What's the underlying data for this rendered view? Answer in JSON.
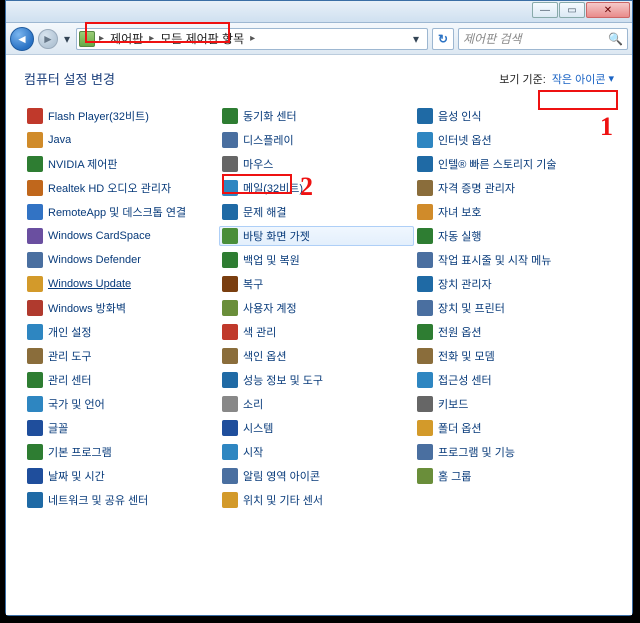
{
  "breadcrumb": {
    "root": "제어판",
    "path": "모든 제어판 항목"
  },
  "search": {
    "placeholder": "제어판 검색"
  },
  "heading": "컴퓨터 설정 변경",
  "view_label": "보기 기준:",
  "view_value": "작은 아이콘",
  "items": [
    {
      "label": "Flash Player(32비트)",
      "icon": "#c0392b"
    },
    {
      "label": "Java",
      "icon": "#d08b2a"
    },
    {
      "label": "NVIDIA 제어판",
      "icon": "#2e7d32"
    },
    {
      "label": "Realtek HD 오디오 관리자",
      "icon": "#c0671c"
    },
    {
      "label": "RemoteApp 및 데스크톱 연결",
      "icon": "#3273c4"
    },
    {
      "label": "Windows CardSpace",
      "icon": "#6a4fa0"
    },
    {
      "label": "Windows Defender",
      "icon": "#4a6fa0"
    },
    {
      "label": "Windows Update",
      "icon": "#d39a2a",
      "underline": true
    },
    {
      "label": "Windows 방화벽",
      "icon": "#b03a2e"
    },
    {
      "label": "개인 설정",
      "icon": "#2e86c1"
    },
    {
      "label": "관리 도구",
      "icon": "#8a6d3b"
    },
    {
      "label": "관리 센터",
      "icon": "#2e7d32"
    },
    {
      "label": "국가 및 언어",
      "icon": "#2e86c1"
    },
    {
      "label": "글꼴",
      "icon": "#1f4e9c"
    },
    {
      "label": "기본 프로그램",
      "icon": "#2e7d32"
    },
    {
      "label": "날짜 및 시간",
      "icon": "#1f4e9c"
    },
    {
      "label": "네트워크 및 공유 센터",
      "icon": "#1f6aa5"
    },
    {
      "label": "동기화 센터",
      "icon": "#2e7d32"
    },
    {
      "label": "디스플레이",
      "icon": "#4a6fa0"
    },
    {
      "label": "마우스",
      "icon": "#666"
    },
    {
      "label": "메일(32비트)",
      "icon": "#2e86c1"
    },
    {
      "label": "문제 해결",
      "icon": "#1f6aa5"
    },
    {
      "label": "바탕 화면 가젯",
      "icon": "#4a8e3a",
      "hover": true
    },
    {
      "label": "백업 및 복원",
      "icon": "#2e7d32"
    },
    {
      "label": "복구",
      "icon": "#7a3e10"
    },
    {
      "label": "사용자 계정",
      "icon": "#6a8e3a"
    },
    {
      "label": "색 관리",
      "icon": "#c0392b"
    },
    {
      "label": "색인 옵션",
      "icon": "#8a6d3b"
    },
    {
      "label": "성능 정보 및 도구",
      "icon": "#1f6aa5"
    },
    {
      "label": "소리",
      "icon": "#888"
    },
    {
      "label": "시스템",
      "icon": "#1f4e9c"
    },
    {
      "label": "시작",
      "icon": "#2e86c1"
    },
    {
      "label": "알림 영역 아이콘",
      "icon": "#4a6fa0"
    },
    {
      "label": "위치 및 기타 센서",
      "icon": "#d39a2a"
    },
    {
      "label": "음성 인식",
      "icon": "#1f6aa5"
    },
    {
      "label": "인터넷 옵션",
      "icon": "#2e86c1"
    },
    {
      "label": "인텔® 빠른 스토리지 기술",
      "icon": "#1f6aa5"
    },
    {
      "label": "자격 증명 관리자",
      "icon": "#8a6d3b"
    },
    {
      "label": "자녀 보호",
      "icon": "#d08b2a"
    },
    {
      "label": "자동 실행",
      "icon": "#2e7d32"
    },
    {
      "label": "작업 표시줄 및 시작 메뉴",
      "icon": "#4a6fa0"
    },
    {
      "label": "장치 관리자",
      "icon": "#1f6aa5"
    },
    {
      "label": "장치 및 프린터",
      "icon": "#4a6fa0"
    },
    {
      "label": "전원 옵션",
      "icon": "#2e7d32"
    },
    {
      "label": "전화 및 모뎀",
      "icon": "#8a6d3b"
    },
    {
      "label": "접근성 센터",
      "icon": "#2e86c1"
    },
    {
      "label": "키보드",
      "icon": "#666"
    },
    {
      "label": "폴더 옵션",
      "icon": "#d39a2a"
    },
    {
      "label": "프로그램 및 기능",
      "icon": "#4a6fa0"
    },
    {
      "label": "홈 그룹",
      "icon": "#6a8e3a"
    }
  ],
  "annotations": {
    "label_2": "2",
    "label_1": "1"
  }
}
